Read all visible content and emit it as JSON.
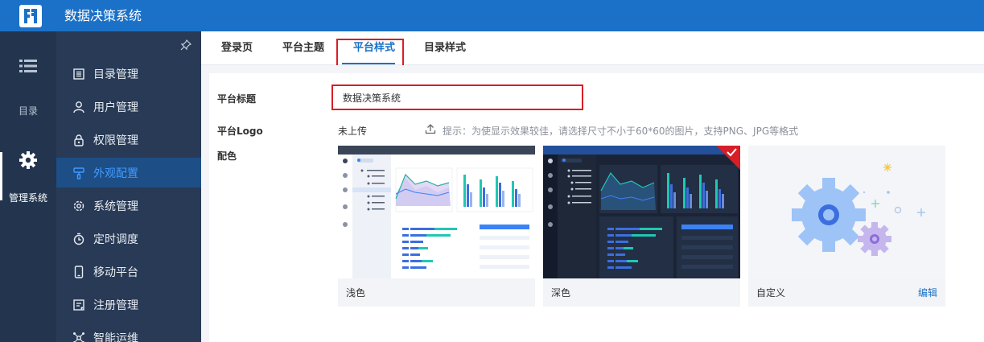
{
  "app": {
    "title": "数据决策系统"
  },
  "rail": {
    "items": [
      {
        "label": "目录",
        "icon": "list-icon"
      },
      {
        "label": "管理系统",
        "icon": "gear-icon"
      }
    ]
  },
  "sidebar": {
    "items": [
      {
        "label": "目录管理",
        "icon": "catalog-icon"
      },
      {
        "label": "用户管理",
        "icon": "user-icon"
      },
      {
        "label": "权限管理",
        "icon": "lock-icon"
      },
      {
        "label": "外观配置",
        "icon": "brush-icon",
        "active": true
      },
      {
        "label": "系统管理",
        "icon": "settings-icon"
      },
      {
        "label": "定时调度",
        "icon": "timer-icon"
      },
      {
        "label": "移动平台",
        "icon": "mobile-icon"
      },
      {
        "label": "注册管理",
        "icon": "register-icon"
      },
      {
        "label": "智能运维",
        "icon": "ops-icon"
      }
    ]
  },
  "tabs": [
    {
      "label": "登录页"
    },
    {
      "label": "平台主题"
    },
    {
      "label": "平台样式",
      "active": true
    },
    {
      "label": "目录样式"
    }
  ],
  "form": {
    "title_label": "平台标题",
    "title_value": "数据决策系统",
    "logo_label": "平台Logo",
    "logo_status": "未上传",
    "logo_hint": "提示：为使显示效果较佳，请选择尺寸不小于60*60的图片，支持PNG、JPG等格式",
    "color_label": "配色"
  },
  "themes": [
    {
      "label": "浅色",
      "selected": false
    },
    {
      "label": "深色",
      "selected": true
    },
    {
      "label": "自定义",
      "action": "编辑",
      "selected": false
    }
  ],
  "colors": {
    "topbar": "#1b71c7",
    "rail": "#22344e",
    "sidebar": "#283a55",
    "active_menu_bg": "#1e4e86",
    "active_text": "#3f9bff",
    "highlight_border": "#d81e26",
    "link": "#1b71c7"
  }
}
